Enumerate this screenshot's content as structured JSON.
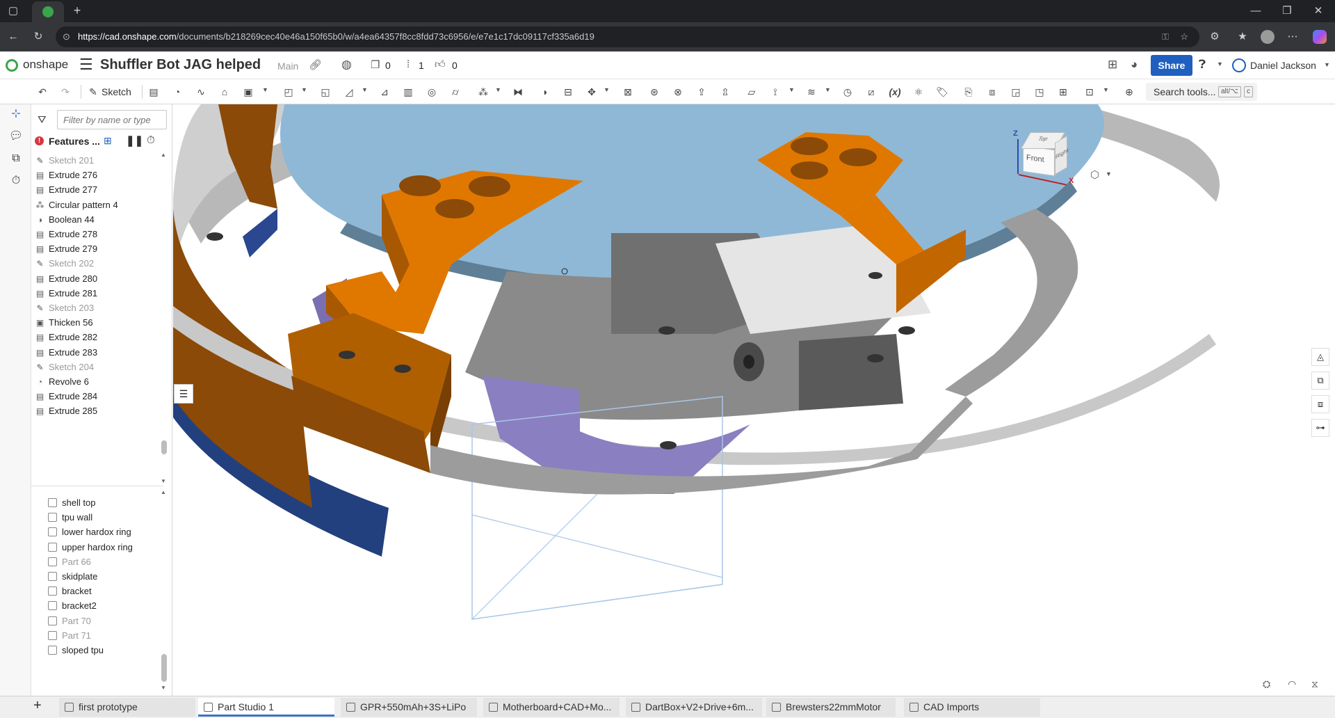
{
  "browser": {
    "url_host": "https://cad.onshape.com",
    "url_path": "/documents/b218269cec40e46a150f65b0/w/a4ea64357f8cc8fdd73c6956/e/e7e1c17dc09117cf335a6d19"
  },
  "header": {
    "brand": "onshape",
    "doc_title": "Shuffler Bot JAG helped",
    "branch": "Main",
    "versions_count": "0",
    "branches_count": "1",
    "likes_count": "0",
    "share_label": "Share",
    "user_name": "Daniel Jackson"
  },
  "toolbar": {
    "sketch_label": "Sketch",
    "search_label": "Search tools...",
    "search_shortcut_a": "alt/⌥",
    "search_shortcut_b": "c"
  },
  "panel": {
    "filter_placeholder": "Filter by name or type",
    "features_label": "Features ...",
    "features": [
      {
        "label": "Sketch 201",
        "icon": "sketch-icon",
        "dim": true
      },
      {
        "label": "Extrude 276",
        "icon": "extrude-icon",
        "dim": false
      },
      {
        "label": "Extrude 277",
        "icon": "extrude-icon",
        "dim": false
      },
      {
        "label": "Circular pattern 4",
        "icon": "pattern-icon",
        "dim": false
      },
      {
        "label": "Boolean 44",
        "icon": "boolean-icon",
        "dim": false
      },
      {
        "label": "Extrude 278",
        "icon": "extrude-icon",
        "dim": false
      },
      {
        "label": "Extrude 279",
        "icon": "extrude-icon",
        "dim": false
      },
      {
        "label": "Sketch 202",
        "icon": "sketch-icon",
        "dim": true
      },
      {
        "label": "Extrude 280",
        "icon": "extrude-icon",
        "dim": false
      },
      {
        "label": "Extrude 281",
        "icon": "extrude-icon",
        "dim": false
      },
      {
        "label": "Sketch 203",
        "icon": "sketch-icon",
        "dim": true
      },
      {
        "label": "Thicken 56",
        "icon": "thicken-icon",
        "dim": false
      },
      {
        "label": "Extrude 282",
        "icon": "extrude-icon",
        "dim": false
      },
      {
        "label": "Extrude 283",
        "icon": "extrude-icon",
        "dim": false
      },
      {
        "label": "Sketch 204",
        "icon": "sketch-icon",
        "dim": true
      },
      {
        "label": "Revolve 6",
        "icon": "revolve-icon",
        "dim": false
      },
      {
        "label": "Extrude 284",
        "icon": "extrude-icon",
        "dim": false
      },
      {
        "label": "Extrude 285",
        "icon": "extrude-icon",
        "dim": false
      }
    ],
    "parts": [
      {
        "label": "shell top",
        "dim": false
      },
      {
        "label": "tpu wall",
        "dim": false
      },
      {
        "label": "lower hardox ring",
        "dim": false
      },
      {
        "label": "upper hardox ring",
        "dim": false
      },
      {
        "label": "Part 66",
        "dim": true
      },
      {
        "label": "skidplate",
        "dim": false
      },
      {
        "label": "bracket",
        "dim": false
      },
      {
        "label": "bracket2",
        "dim": false
      },
      {
        "label": "Part 70",
        "dim": true
      },
      {
        "label": "Part 71",
        "dim": true
      },
      {
        "label": "sloped tpu",
        "dim": false
      }
    ]
  },
  "viewcube": {
    "top": "Top",
    "front": "Front",
    "right": "Right",
    "axis_z": "Z",
    "axis_x": "X"
  },
  "tabs": [
    {
      "label": "first prototype",
      "active": false
    },
    {
      "label": "Part Studio 1",
      "active": true
    },
    {
      "label": "GPR+550mAh+3S+LiPo",
      "active": false
    },
    {
      "label": "Motherboard+CAD+Mo...",
      "active": false
    },
    {
      "label": "DartBox+V2+Drive+6m...",
      "active": false
    },
    {
      "label": "Brewsters22mmMotor",
      "active": false
    },
    {
      "label": "CAD Imports",
      "active": false
    }
  ],
  "colors": {
    "orange": "#e07800",
    "brown": "#8b4a07",
    "blue_plate": "#8fb8d6",
    "gray": "#8a8a8a",
    "purple": "#8a7fc0",
    "navy": "#22407e",
    "accent": "#1f5fbf"
  }
}
